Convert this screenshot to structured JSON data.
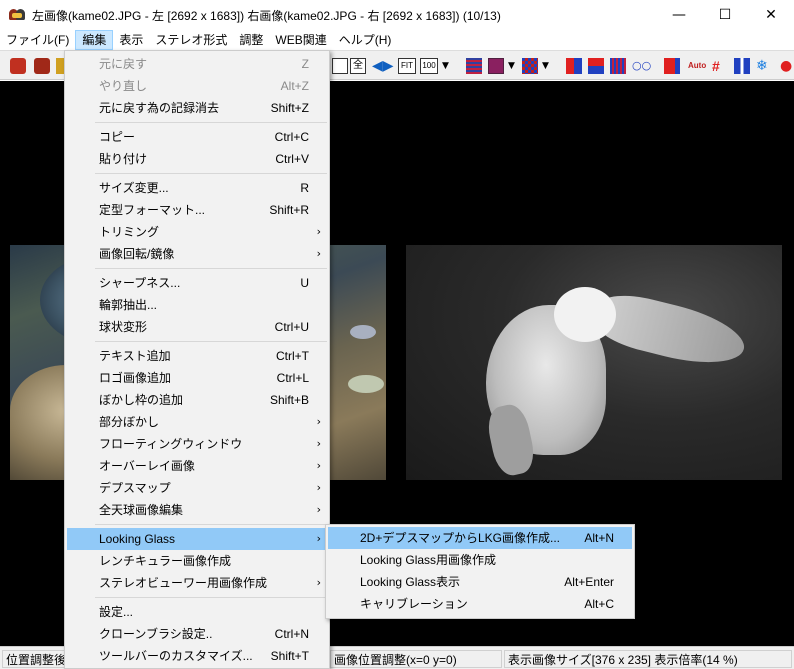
{
  "window": {
    "title": "左画像(kame02.JPG - 左 [2692 x 1683]) 右画像(kame02.JPG - 右 [2692 x 1683])  (10/13)",
    "minimize": "—",
    "maximize": "☐",
    "close": "✕"
  },
  "menubar": {
    "items": [
      {
        "label": "ファイル(F)"
      },
      {
        "label": "編集"
      },
      {
        "label": "表示"
      },
      {
        "label": "ステレオ形式"
      },
      {
        "label": "調整"
      },
      {
        "label": "WEB関連"
      },
      {
        "label": "ヘルプ(H)"
      }
    ]
  },
  "toolbar": {
    "fit_label": "FIT",
    "zoom_label": "100",
    "auto_label": "Auto"
  },
  "edit_menu": {
    "items": [
      {
        "label": "元に戻す",
        "shortcut": "Z",
        "disabled": true
      },
      {
        "label": "やり直し",
        "shortcut": "Alt+Z",
        "disabled": true
      },
      {
        "label": "元に戻す為の記録消去",
        "shortcut": "Shift+Z"
      },
      {
        "label": "コピー",
        "shortcut": "Ctrl+C"
      },
      {
        "label": "貼り付け",
        "shortcut": "Ctrl+V"
      },
      {
        "label": "サイズ変更...",
        "shortcut": "R"
      },
      {
        "label": "定型フォーマット...",
        "shortcut": "Shift+R"
      },
      {
        "label": "トリミング",
        "submenu": true
      },
      {
        "label": "画像回転/鏡像",
        "submenu": true
      },
      {
        "label": "シャープネス...",
        "shortcut": "U"
      },
      {
        "label": "輪郭抽出..."
      },
      {
        "label": "球状変形",
        "shortcut": "Ctrl+U"
      },
      {
        "label": "テキスト追加",
        "shortcut": "Ctrl+T"
      },
      {
        "label": "ロゴ画像追加",
        "shortcut": "Ctrl+L"
      },
      {
        "label": "ぼかし枠の追加",
        "shortcut": "Shift+B"
      },
      {
        "label": "部分ぼかし",
        "submenu": true
      },
      {
        "label": "フローティングウィンドウ",
        "submenu": true
      },
      {
        "label": "オーバーレイ画像",
        "submenu": true
      },
      {
        "label": "デプスマップ",
        "submenu": true
      },
      {
        "label": "全天球画像編集",
        "submenu": true
      },
      {
        "label": "Looking Glass",
        "submenu": true,
        "highlighted": true
      },
      {
        "label": "レンチキュラー画像作成"
      },
      {
        "label": "ステレオビューワー用画像作成",
        "submenu": true
      },
      {
        "label": "設定..."
      },
      {
        "label": "クローンブラシ設定..",
        "shortcut": "Ctrl+N"
      },
      {
        "label": "ツールバーのカスタマイズ...",
        "shortcut": "Shift+T"
      }
    ]
  },
  "looking_glass_submenu": {
    "items": [
      {
        "label": "2D+デプスマップからLKG画像作成...",
        "shortcut": "Alt+N",
        "highlighted": true
      },
      {
        "label": "Looking Glass用画像作成",
        "shortcut": ""
      },
      {
        "label": "Looking Glass表示",
        "shortcut": "Alt+Enter"
      },
      {
        "label": "キャリブレーション",
        "shortcut": "Alt+C"
      }
    ]
  },
  "statusbar": {
    "left": "位置調整後",
    "middle": "画像位置調整(x=0 y=0)",
    "right": "表示画像サイズ[376 x 235]  表示倍率(14 %)"
  },
  "colors": {
    "menu_highlight": "#91c9f7",
    "menubar_active": "#cce8ff",
    "canvas": "#000000"
  }
}
